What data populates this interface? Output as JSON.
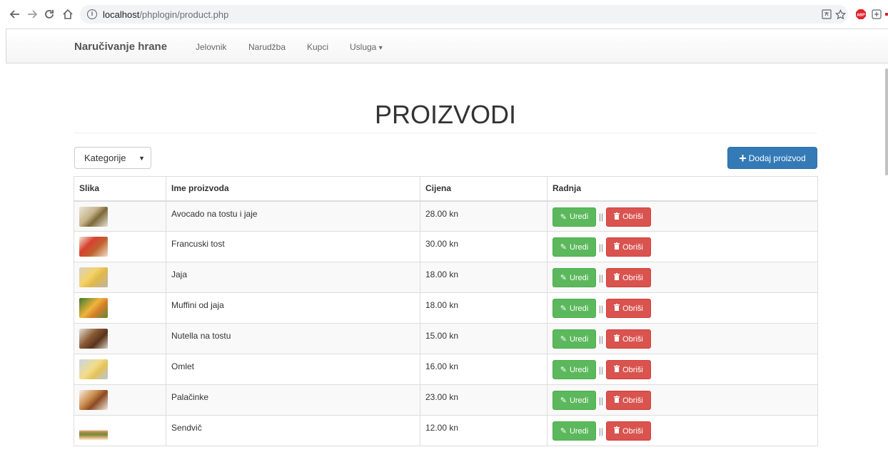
{
  "browser": {
    "url_host": "localhost",
    "url_path": "/phplogin/product.php"
  },
  "navbar": {
    "brand": "Naručivanje hrane",
    "links": [
      "Jelovnik",
      "Narudžba",
      "Kupci",
      "Usluga"
    ],
    "dropdown_caret": "▾"
  },
  "page": {
    "title": "PROIZVODI",
    "category_select": "Kategorije",
    "add_button": "Dodaj proizvod"
  },
  "table": {
    "headers": [
      "Slika",
      "Ime proizvoda",
      "Cijena",
      "Radnja"
    ],
    "edit_label": "Uredi",
    "delete_label": "Obriši",
    "separator": "||",
    "rows": [
      {
        "name": "Avocado na tostu i jaje",
        "price": "28.00 kn"
      },
      {
        "name": "Francuski tost",
        "price": "30.00 kn"
      },
      {
        "name": "Jaja",
        "price": "18.00 kn"
      },
      {
        "name": "Muffini od jaja",
        "price": "18.00 kn"
      },
      {
        "name": "Nutella na tostu",
        "price": "15.00 kn"
      },
      {
        "name": "Omlet",
        "price": "16.00 kn"
      },
      {
        "name": "Palačinke",
        "price": "23.00 kn"
      },
      {
        "name": "Sendvič",
        "price": "12.00 kn"
      }
    ]
  },
  "colors": {
    "primary": "#337ab7",
    "success": "#5cb85c",
    "danger": "#d9534f"
  }
}
